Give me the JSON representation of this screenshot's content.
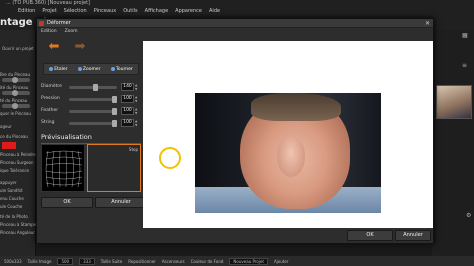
{
  "app": {
    "title": "... (TO PUB.360) [Nouveau projet]",
    "menu": [
      "Edition",
      "Projet",
      "Sélection",
      "Pinceaux",
      "Outils",
      "Affichage",
      "Apparence",
      "Aide"
    ],
    "big_title": "ntage Phot",
    "left_tools": [
      "Ouvrir un projet",
      "Bre du Pinceau",
      "ité du Pinceau",
      "té du Pinceau",
      "quer le Pinceau",
      "ageur",
      "ce du Pinceau",
      "Pinceau à Peindre",
      "Pinceau Surgeon",
      "ique Tolérance",
      "appuyer",
      "ule Sandhit",
      "enu Couche",
      "ule Couche",
      "té de la Photo",
      "Pinceau à Stamper",
      "Pinceau Anguleur"
    ],
    "status": {
      "size": "500x333",
      "taille_label": "Taille Image",
      "width": "500",
      "height": "333",
      "taille_suite": "Taille Suite",
      "repositionner": "Repositionner",
      "ascenseurs": "Ascenseurs",
      "couleur_fond": "Couleur de Fond",
      "projet": "Nouveau Projet",
      "ajouter": "Ajouter"
    }
  },
  "dialog": {
    "title": "Déformer",
    "close": "✕",
    "menu": [
      "Edition",
      "Zoom"
    ],
    "tools": [
      "Etaler",
      "Zoomer",
      "Tourner"
    ],
    "params": [
      {
        "label": "Diamètre",
        "value": "140",
        "fraction": 0.55
      },
      {
        "label": "Pression",
        "value": "100",
        "fraction": 1.0
      },
      {
        "label": "Feather",
        "value": "100",
        "fraction": 1.0
      },
      {
        "label": "String",
        "value": "100",
        "fraction": 1.0
      }
    ],
    "preview_title": "Prévisualisation",
    "stop_label": "Stop",
    "ok_label": "OK",
    "cancel_label": "Annuler"
  }
}
